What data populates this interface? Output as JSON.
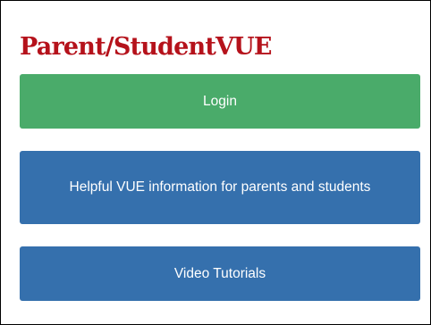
{
  "header": {
    "title": "Parent/StudentVUE"
  },
  "buttons": {
    "login_label": "Login",
    "info_label": "Helpful VUE information for parents and students",
    "video_label": "Video Tutorials"
  },
  "colors": {
    "title": "#b5121b",
    "login_button": "#4aab6a",
    "info_button": "#3570ad",
    "border": "#000000"
  }
}
